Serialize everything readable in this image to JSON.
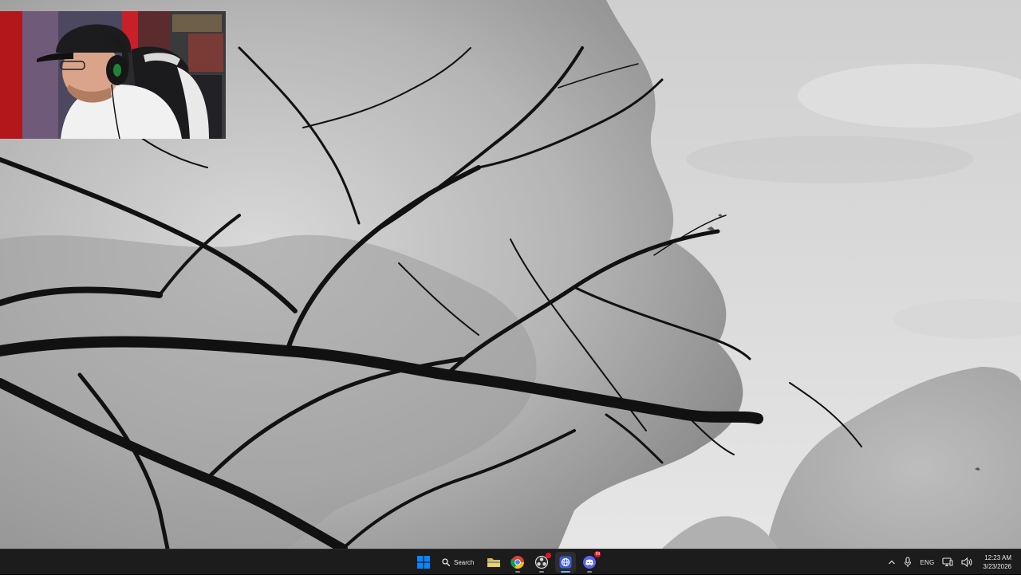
{
  "taskbar": {
    "search_label": "Search",
    "pinned_apps": [
      {
        "name": "File Explorer",
        "icon": "folder-icon"
      },
      {
        "name": "Google Chrome",
        "icon": "chrome-icon"
      },
      {
        "name": "OBS Studio",
        "icon": "obs-icon"
      },
      {
        "name": "Web App",
        "icon": "globe-icon"
      },
      {
        "name": "Discord",
        "icon": "discord-icon",
        "badge": "99"
      }
    ],
    "accent_color": "#6fb8ff"
  },
  "tray": {
    "language": "ENG",
    "time": "12:23 AM",
    "date": "3/23/2026"
  },
  "colors": {
    "taskbar_bg": "#1c1c1c",
    "windows_blue": "#0a84ff",
    "discord_blurple": "#5865f2"
  }
}
